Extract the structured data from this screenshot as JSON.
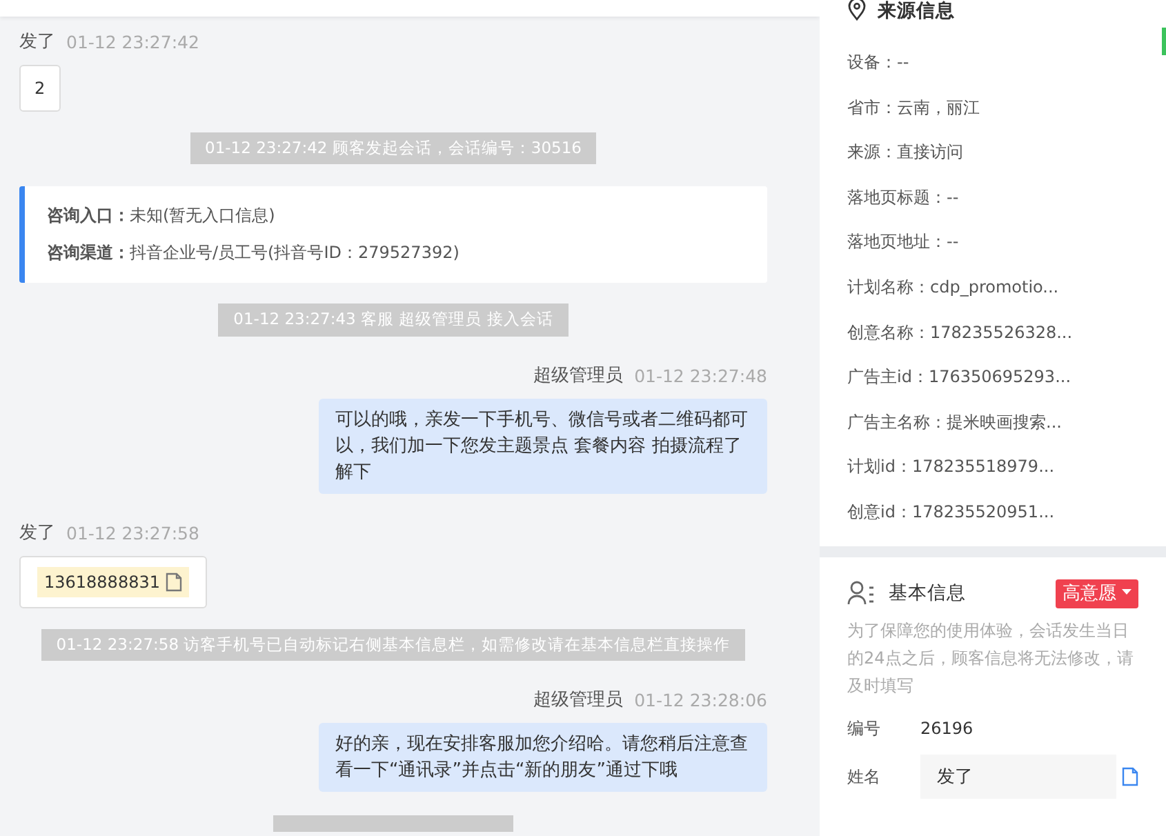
{
  "chat": [
    {
      "kind": "customer",
      "name": "发了",
      "time": "01-12 23:27:42",
      "highlighted": false,
      "text": "2"
    },
    {
      "kind": "system",
      "text": "01-12 23:27:42 顾客发起会话，会话编号：30516"
    },
    {
      "kind": "entry",
      "rows": [
        {
          "label": "咨询入口：",
          "value": "未知(暂无入口信息)"
        },
        {
          "label": "咨询渠道：",
          "value": "抖音企业号/员工号(抖音号ID：279527392)"
        }
      ]
    },
    {
      "kind": "system",
      "text": "01-12 23:27:43 客服 超级管理员 接入会话"
    },
    {
      "kind": "agent",
      "name": "超级管理员",
      "time": "01-12 23:27:48",
      "text": "可以的哦，亲发一下手机号、微信号或者二维码都可以，我们加一下您发主题景点 套餐内容 拍摄流程了解下"
    },
    {
      "kind": "customer",
      "name": "发了",
      "time": "01-12 23:27:58",
      "highlighted": true,
      "text": "13618888831"
    },
    {
      "kind": "system",
      "text": "01-12 23:27:58 访客手机号已自动标记右侧基本信息栏，如需修改请在基本信息栏直接操作"
    },
    {
      "kind": "agent",
      "name": "超级管理员",
      "time": "01-12 23:28:06",
      "text": "好的亲，现在安排客服加您介绍哈。请您稍后注意查看一下“通讯录”并点击“新的朋友”通过下哦"
    },
    {
      "kind": "system_cut"
    }
  ],
  "source": {
    "title": "来源信息",
    "fields": [
      "设备：--",
      "省市：云南，丽江",
      "来源：直接访问",
      "落地页标题：--",
      "落地页地址：--",
      "计划名称：cdp_promotio...",
      "创意名称：178235526328...",
      "广告主id：176350695293...",
      "广告主名称：提米映画搜索...",
      "计划id：178235518979...",
      "创意id：178235520951..."
    ]
  },
  "basic": {
    "title": "基本信息",
    "tag": "高意愿",
    "notice": "为了保障您的使用体验，会话发生当日的24点之后，顾客信息将无法修改，请及时填写",
    "rows": [
      {
        "kind": "text",
        "label": "编号",
        "value": "26196"
      },
      {
        "kind": "field",
        "label": "姓名",
        "value": "发了"
      }
    ]
  }
}
